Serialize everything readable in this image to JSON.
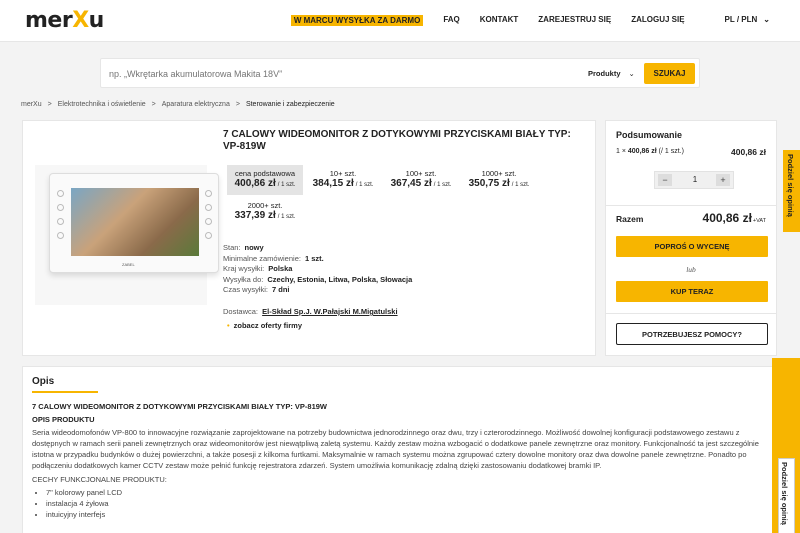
{
  "header": {
    "logo": "merXu",
    "promo": "W MARCU WYSYŁKA ZA DARMO",
    "faq": "FAQ",
    "contact": "KONTAKT",
    "register": "ZAREJESTRUJ SIĘ",
    "login": "ZALOGUJ SIĘ",
    "locale": "PL / PLN"
  },
  "search": {
    "placeholder": "np. „Wkrętarka akumulatorowa Makita 18V”",
    "category": "Produkty",
    "button": "SZUKAJ"
  },
  "breadcrumb": [
    "merXu",
    "Elektrotechnika i oświetlenie",
    "Aparatura elektryczna",
    "Sterowanie i zabezpieczenie"
  ],
  "product": {
    "title": "7 CALOWY WIDEOMONITOR Z DOTYKOWYMI PRZYCISKAMI BIAŁY TYP: VP-819W",
    "brand_on_device": "ZABEL",
    "prices": [
      {
        "qty": "cena podstawowa",
        "amount": "400,86 zł",
        "unit": "/ 1 szt."
      },
      {
        "qty": "10+ szt.",
        "amount": "384,15 zł",
        "unit": "/ 1 szt."
      },
      {
        "qty": "100+ szt.",
        "amount": "367,45 zł",
        "unit": "/ 1 szt."
      },
      {
        "qty": "1000+ szt.",
        "amount": "350,75 zł",
        "unit": "/ 1 szt."
      },
      {
        "qty": "2000+ szt.",
        "amount": "337,39 zł",
        "unit": "/ 1 szt."
      }
    ],
    "specs": [
      {
        "label": "Stan:",
        "value": "nowy"
      },
      {
        "label": "Minimalne zamówienie:",
        "value": "1 szt."
      },
      {
        "label": "Kraj wysyłki:",
        "value": "Polska"
      },
      {
        "label": "Wysyłka do:",
        "value": "Czechy, Estonia, Litwa, Polska, Słowacja"
      },
      {
        "label": "Czas wysyłki:",
        "value": "7 dni"
      }
    ],
    "supplier_label": "Dostawca:",
    "supplier": "El-Skład Sp.J. W.Pałajski M.Migatulski",
    "offers_link": "zobacz oferty firmy"
  },
  "summary": {
    "title": "Podsumowanie",
    "line_qty": "1 ×",
    "line_price": "400,86 zł",
    "line_unit": "(/ 1 szt.)",
    "line_total": "400,86 zł",
    "quantity": "1",
    "minus": "−",
    "plus": "+",
    "total_label": "Razem",
    "total_value": "400,86 zł",
    "vat": "+VAT",
    "quote_button": "POPROŚ O WYCENĘ",
    "or": "lub",
    "buy_button": "KUP TERAZ",
    "help_button": "POTRZEBUJESZ POMOCY?"
  },
  "share": {
    "label_1": "Podziel się opinią",
    "label_2": "Podziel się opinią"
  },
  "description": {
    "title": "Opis",
    "heading": "7 CALOWY WIDEOMONITOR Z DOTYKOWYMI PRZYCISKAMI BIAŁY TYP: VP-819W",
    "subheading": "OPIS PRODUKTU",
    "paragraph": "Seria wideodomofonów VP-800 to innowacyjne rozwiązanie zaprojektowane na potrzeby budownictwa jednorodzinnego oraz dwu, trzy i czterorodzinnego. Możliwość dowolnej konfiguracji podstawowego zestawu z dostępnych w ramach serii paneli zewnętrznych oraz wideomonitorów jest niewątpliwą zaletą systemu. Każdy zestaw można wzbogacić o dodatkowe panele zewnętrzne oraz monitory. Funkcjonalność ta jest szczególnie istotna w przypadku budynków o dużej powierzchni, a także posesji z kilkoma furtkami. Maksymalnie w ramach systemu można zgrupować cztery dowolne monitory oraz dwa dowolne panele zewnętrzne. Ponadto po podłączeniu dodatkowych kamer CCTV zestaw może pełnić funkcję rejestratora zdarzeń. System umożliwia komunikację zdalną dzięki zastosowaniu dodatkowej bramki IP.",
    "features_title": "CECHY FUNKCJONALNE PRODUKTU:",
    "features": [
      "7\" kolorowy panel LCD",
      "instalacja 4 żyłowa",
      "intuicyjny interfejs"
    ]
  },
  "colors": {
    "accent": "#f7b500",
    "background": "#f3f3f3"
  }
}
